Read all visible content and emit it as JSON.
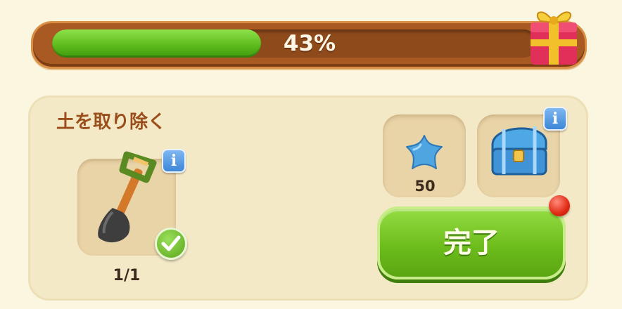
{
  "progress": {
    "label": "43%",
    "percent": 43,
    "fill_color": "#5ab81a",
    "reward_icon": "gift-box-icon"
  },
  "task": {
    "title": "土を取り除く",
    "required_item": {
      "icon": "shovel-icon",
      "count": "1/1",
      "info_label": "i",
      "status_icon": "checkmark-icon"
    }
  },
  "rewards": [
    {
      "icon": "blue-star-icon",
      "value": "50"
    },
    {
      "icon": "treasure-chest-icon",
      "info_label": "i"
    }
  ],
  "actions": {
    "done_label": "完了",
    "notification_icon": "red-dot-icon"
  }
}
